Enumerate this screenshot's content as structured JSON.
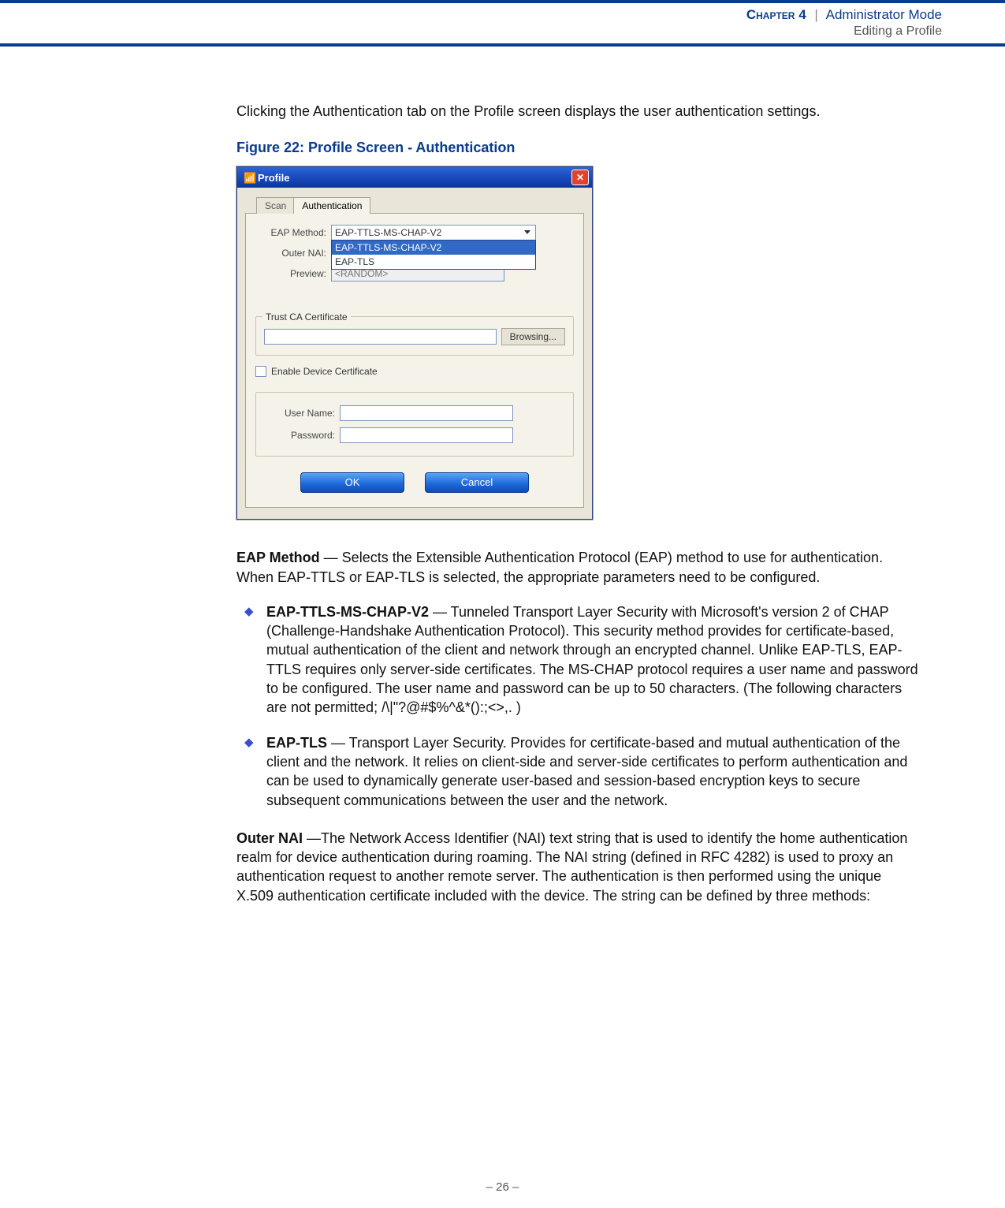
{
  "header": {
    "chapter_label": "Chapter 4",
    "separator": "|",
    "title": "Administrator Mode",
    "subtitle": "Editing a Profile"
  },
  "intro": "Clicking the Authentication tab on the Profile screen displays the user authentication settings.",
  "figure_caption": "Figure 22:  Profile Screen - Authentication",
  "dialog": {
    "title": "Profile",
    "icon_name": "antenna-icon",
    "tabs": {
      "scan": "Scan",
      "auth": "Authentication"
    },
    "labels": {
      "eap_method": "EAP Method:",
      "outer_nai": "Outer NAI:",
      "preview": "Preview:",
      "user_name": "User Name:",
      "password": "Password:"
    },
    "eap_method_value": "EAP-TTLS-MS-CHAP-V2",
    "eap_method_options": [
      "EAP-TTLS-MS-CHAP-V2",
      "EAP-TLS"
    ],
    "preview_placeholder": "<RANDOM>",
    "trust_ca_legend": "Trust CA Certificate",
    "browse_label": "Browsing...",
    "enable_device_cert": "Enable Device Certificate",
    "buttons": {
      "ok": "OK",
      "cancel": "Cancel"
    }
  },
  "body": {
    "eap_method_heading": "EAP Method",
    "eap_method_text": " — Selects the Extensible Authentication Protocol (EAP) method to use for authentication. When EAP-TTLS or EAP-TLS is selected, the appropriate parameters need to be configured.",
    "bullets": [
      {
        "title": "EAP-TTLS-MS-CHAP-V2",
        "text": " — Tunneled Transport Layer Security with Microsoft's version 2 of CHAP (Challenge-Handshake Authentication Protocol). This security method provides for certificate-based, mutual authentication of the client and network through an encrypted channel. Unlike EAP-TLS, EAP-TTLS requires only server-side certificates. The MS-CHAP protocol requires a user name and password to be configured. The user name and password can be up to 50 characters. (The following characters are not permitted; /\\|\"?@#$%^&*():;<>,. )"
      },
      {
        "title": "EAP-TLS",
        "text": " — Transport Layer Security. Provides for certificate-based and mutual authentication of the client and the network. It relies on client-side and server-side certificates to perform authentication and can be used to dynamically generate user-based and session-based encryption keys to secure subsequent communications between the user and the network."
      }
    ],
    "outer_nai_heading": "Outer NAI",
    "outer_nai_text": " —The Network Access Identifier (NAI) text string that is used to identify the home authentication realm for device authentication during roaming. The NAI string (defined in RFC 4282) is used to proxy an authentication request to another remote server. The authentication is then performed using the unique X.509 authentication certificate included with the device. The string can be defined by three methods:"
  },
  "footer": "–  26  –"
}
